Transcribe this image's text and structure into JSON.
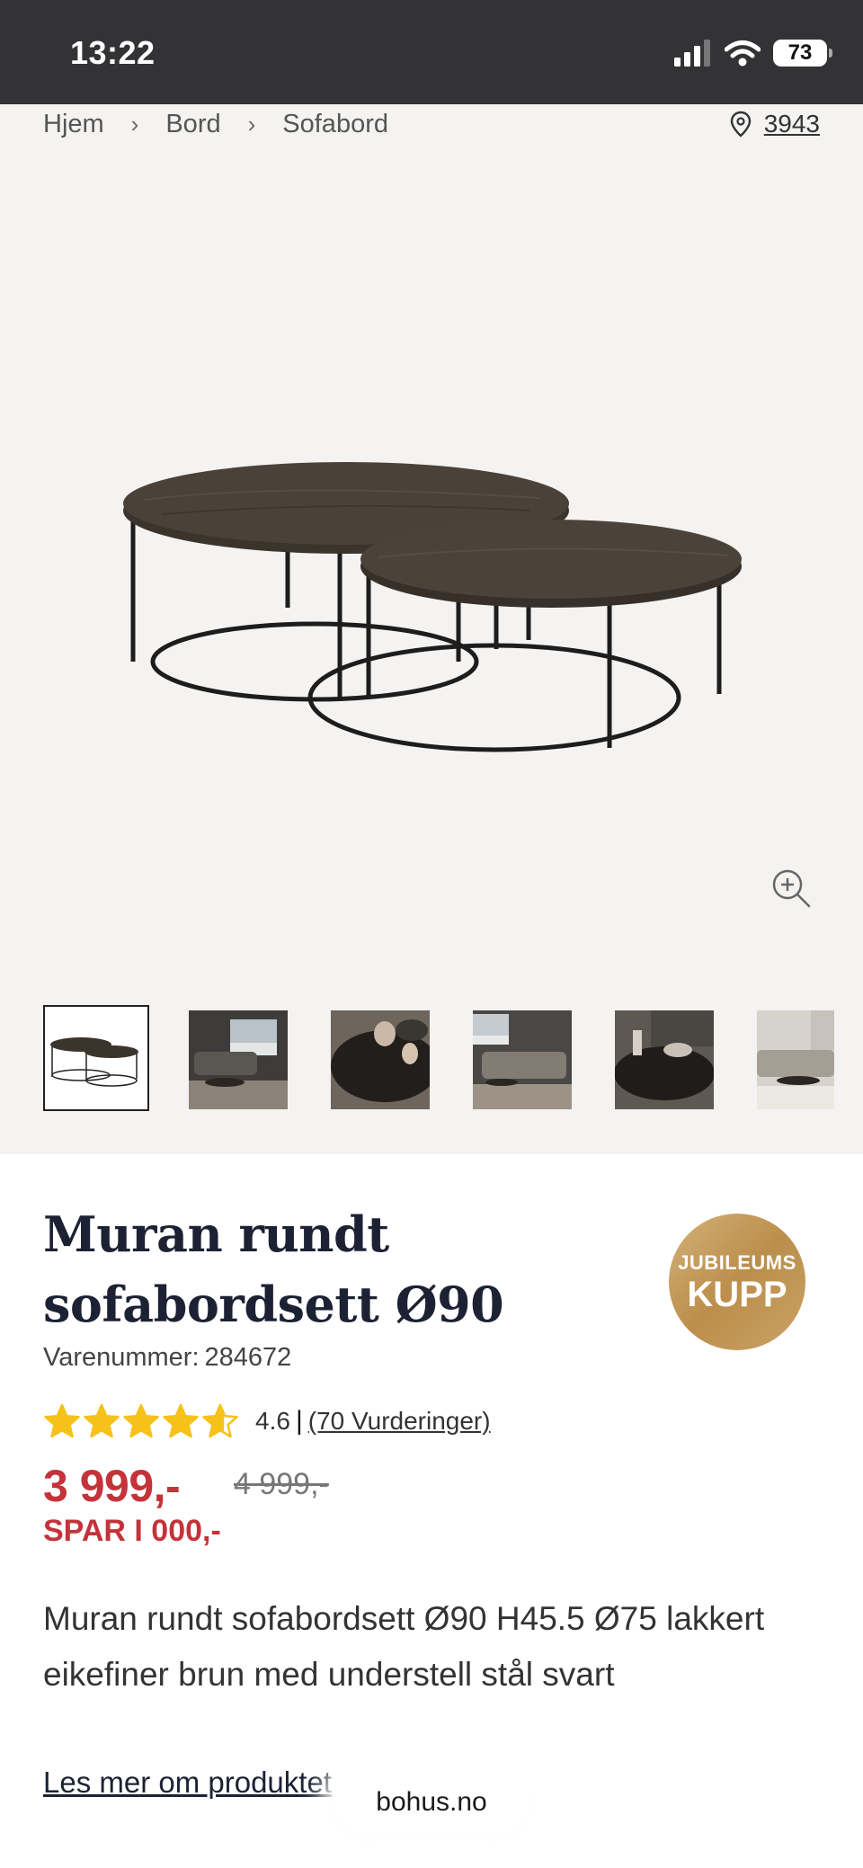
{
  "status_bar": {
    "time": "13:22",
    "battery": "73",
    "icons": [
      "signal-icon",
      "wifi-icon",
      "battery-icon"
    ]
  },
  "breadcrumb": [
    "Hjem",
    "Bord",
    "Sofabord"
  ],
  "store": {
    "number": "3943",
    "icon": "location-pin-icon"
  },
  "gallery": {
    "thumbnail_count": 6,
    "active_index": 0,
    "zoom_icon": "zoom-in-icon"
  },
  "product": {
    "title_line1": "Muran rundt",
    "title_line2": "sofabordsett Ø90",
    "sku_label": "Varenummer:",
    "sku": "284672",
    "badge_top": "JUBILEUMS",
    "badge_main": "KUPP",
    "rating_value": "4.6",
    "rating_sep": "|",
    "rating_link": "(70 Vurderinger)",
    "rating_stars": 4.6,
    "price": "3 999,-",
    "old_price": "4 999,-",
    "save": "SPAR I 000,-",
    "description": "Muran rundt sofabordsett Ø90 H45.5 Ø75 lakkert eikefiner brun med understell stål svart",
    "read_more": "Les mer om produktet"
  },
  "browser": {
    "domain": "bohus.no"
  },
  "colors": {
    "status_bar": "#333335",
    "gallery_bg": "#f4f3f1",
    "price_red": "#c4333a",
    "star_yellow": "#f6c21a",
    "badge_gold": "#c9a365",
    "title_navy": "#1c2233"
  }
}
